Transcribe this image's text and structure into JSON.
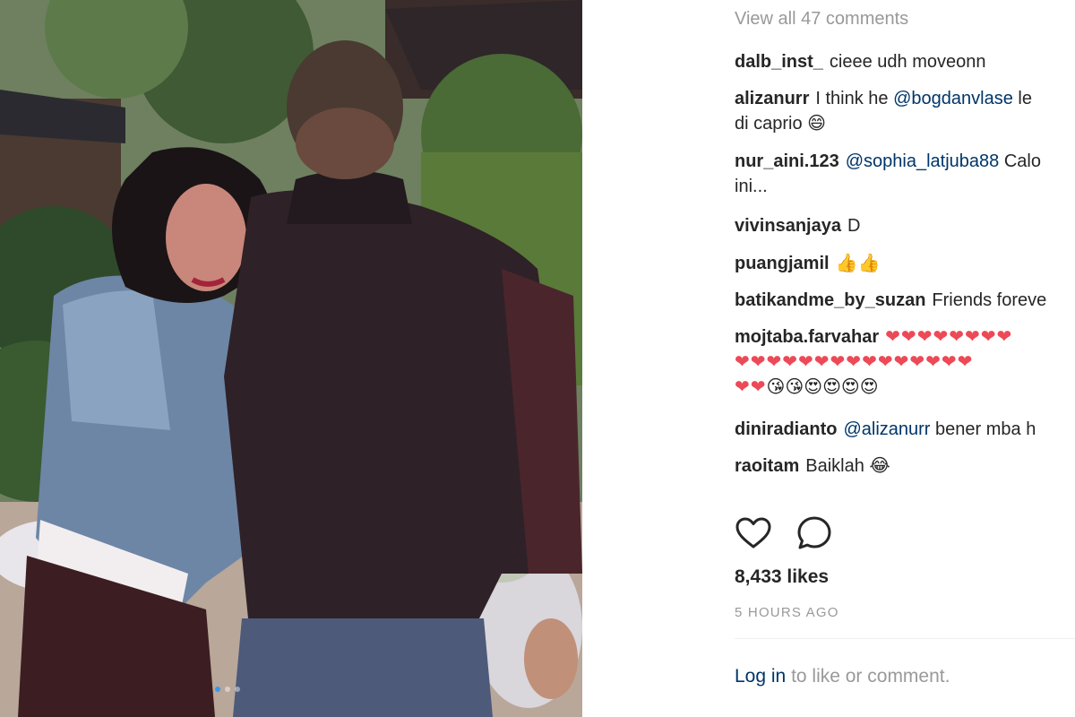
{
  "comments_panel": {
    "view_all": "View all 47 comments",
    "comments": [
      {
        "user": "dalb_inst_",
        "text": "cieee udh moveonn"
      },
      {
        "user": "alizanurr",
        "text": "I think he",
        "mention": "@bogdanvlase",
        "text_after": "le",
        "line2": "di caprio",
        "emoji": "😄"
      },
      {
        "user": "nur_aini.123",
        "mention": "@sophia_latjuba88",
        "text_after": "Calo",
        "line2": "ini..."
      },
      {
        "user": "vivinsanjaya",
        "text": "D"
      },
      {
        "user": "puangjamil",
        "emoji": "👍👍"
      },
      {
        "user": "batikandme_by_suzan",
        "text": "Friends foreve"
      },
      {
        "user": "mojtaba.farvahar",
        "hearts_line1": "❤❤❤❤❤❤❤❤",
        "hearts_line2": "❤❤❤❤❤❤❤❤❤❤❤❤❤❤❤",
        "hearts_line3": "❤❤",
        "emoji_line3": "😘😘😍😍😍😍"
      },
      {
        "user": "diniradianto",
        "mention": "@alizanurr",
        "text_after": "bener mba h"
      },
      {
        "user": "raoitam",
        "text": "Baiklah",
        "emoji": "😂"
      }
    ]
  },
  "actions": {
    "like_icon": "heart-outline-icon",
    "comment_icon": "speech-bubble-icon"
  },
  "likes": "8,433 likes",
  "time": "5 HOURS AGO",
  "login": {
    "link": "Log in",
    "text": "to like or comment."
  },
  "colors": {
    "username": "#262626",
    "mention": "#003569",
    "muted": "#999999",
    "heart": "#ed4956"
  }
}
